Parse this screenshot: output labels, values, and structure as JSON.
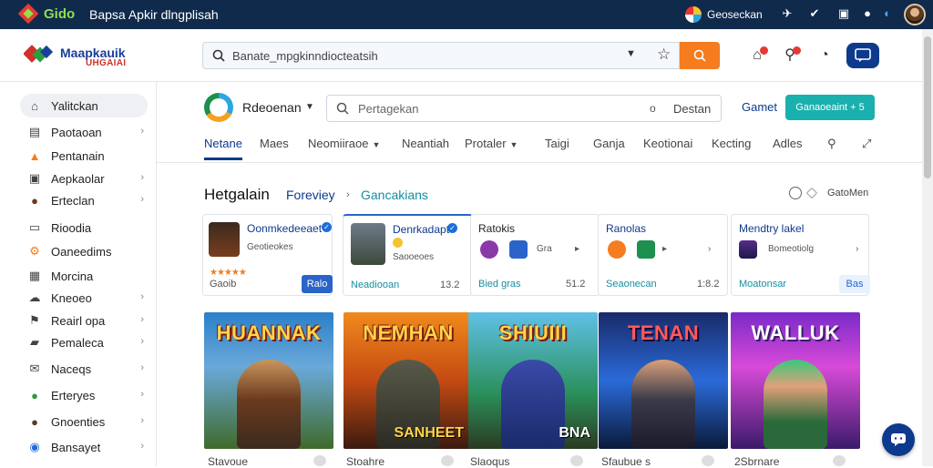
{
  "window": {
    "brand": "Gido",
    "title": "Bapsa Apkir dlngplisah"
  },
  "topbar": {
    "account_label": "Geoseckan",
    "icons": [
      "pin-icon",
      "check-icon",
      "box-icon",
      "bell-icon",
      "shield-icon"
    ]
  },
  "app": {
    "name_line1": "Maapkauik",
    "name_line2": "UHGAIAI"
  },
  "main_search": {
    "value": "Banate_mpgkinndiocteatsih"
  },
  "sidebar": {
    "items": [
      {
        "label": "Yalitckan",
        "icon": "home-icon",
        "active": true,
        "chevron": false
      },
      {
        "label": "Paotaoan",
        "icon": "tag-icon",
        "active": false,
        "chevron": true
      },
      {
        "label": "Pentanain",
        "icon": "alert-icon",
        "active": false,
        "chevron": false
      },
      {
        "label": "Aepkaolar",
        "icon": "apps-icon",
        "active": false,
        "chevron": true
      },
      {
        "label": "Erteclan",
        "icon": "user-icon",
        "active": false,
        "chevron": true
      },
      {
        "label": "Rioodia",
        "icon": "monitor-icon",
        "active": false,
        "chevron": false
      },
      {
        "label": "Oaneedims",
        "icon": "settings-icon",
        "active": false,
        "chevron": false
      },
      {
        "label": "Morcina",
        "icon": "grid-icon",
        "active": false,
        "chevron": false
      },
      {
        "label": "Kneoeo",
        "icon": "cloud-icon",
        "active": false,
        "chevron": true
      },
      {
        "label": "Reairl opa",
        "icon": "flag-icon",
        "active": false,
        "chevron": true
      },
      {
        "label": "Pemaleca",
        "icon": "bookmark-icon",
        "active": false,
        "chevron": true
      },
      {
        "label": "Naceqs",
        "icon": "mail-icon",
        "active": false,
        "chevron": true
      },
      {
        "label": "Erteryes",
        "icon": "leaf-icon",
        "active": false,
        "chevron": true
      },
      {
        "label": "Gnoenties",
        "icon": "person-icon",
        "active": false,
        "chevron": true
      },
      {
        "label": "Bansayet",
        "icon": "info-icon",
        "active": false,
        "chevron": true
      }
    ]
  },
  "store": {
    "name": "Rdeoenan",
    "search_placeholder": "Pertagekan",
    "search_mid": "o",
    "search_button": "Destan",
    "link": "Gamet",
    "subscribe": "Ganaoeaint + 5"
  },
  "tabs": [
    {
      "label": "Netane",
      "active": true,
      "caret": false
    },
    {
      "label": "Maes",
      "active": false,
      "caret": false
    },
    {
      "label": "Neomiiraoe",
      "active": false,
      "caret": true
    },
    {
      "label": "Neantiah",
      "active": false,
      "caret": false
    },
    {
      "label": "Protaler",
      "active": false,
      "caret": true
    },
    {
      "label": "Taigi",
      "active": false,
      "caret": false
    },
    {
      "label": "Ganja",
      "active": false,
      "caret": false
    },
    {
      "label": "Keotionai",
      "active": false,
      "caret": false
    },
    {
      "label": "Kecting",
      "active": false,
      "caret": false
    },
    {
      "label": "Adles",
      "active": false,
      "caret": false
    }
  ],
  "section": {
    "title": "Hetgalain",
    "link1": "Foreviey",
    "link2": "Gancakians",
    "right_text": "GatoMen"
  },
  "cards": [
    {
      "title": "Oonmkedeeaet",
      "sub": "Geotieokes",
      "bottom": "Gaoib",
      "button": "Ralo",
      "num": ""
    },
    {
      "title": "Denrkadapt",
      "sub": "Saooeoes",
      "bottom": "Neadiooan",
      "button": "",
      "num": "13.2"
    },
    {
      "title": "Ratokis",
      "sub": "Gra",
      "bottom": "Bied gras",
      "button": "",
      "num": "51.2"
    },
    {
      "title": "Ranolas",
      "sub": "",
      "bottom": "Seaonecan",
      "button": "",
      "num": "1:8.2"
    },
    {
      "title": "Mendtry lakel",
      "sub": "Bomeotiolg",
      "bottom": "Moatonsar",
      "button": "Bas",
      "num": ""
    }
  ],
  "tiles": [
    {
      "title": "HUANNAK",
      "footer": "",
      "caption": "Stavoue"
    },
    {
      "title": "NEMHAN",
      "footer": "SANHEET",
      "caption": "Stoahre"
    },
    {
      "title": "SHIUIII",
      "footer": "BNA",
      "caption": "Slaoqus"
    },
    {
      "title": "TENAN",
      "footer": "",
      "caption": "Sfaubue s"
    },
    {
      "title": "WALLUK",
      "footer": "",
      "caption": "2Sbrnare"
    }
  ],
  "colors": {
    "topbar": "#102a4c",
    "accent": "#0d3a8c",
    "orange": "#f57c1f",
    "teal": "#1ab0ad"
  }
}
